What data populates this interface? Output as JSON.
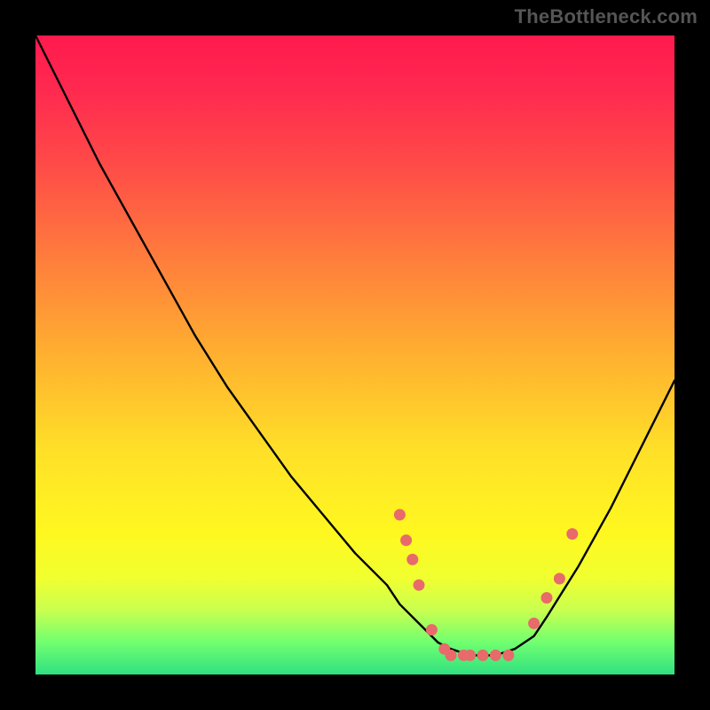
{
  "watermark": "TheBottleneck.com",
  "chart_data": {
    "type": "line",
    "title": "",
    "xlabel": "",
    "ylabel": "",
    "xlim": [
      0,
      100
    ],
    "ylim": [
      0,
      100
    ],
    "series": [
      {
        "name": "bottleneck-curve",
        "x": [
          0,
          5,
          10,
          15,
          20,
          25,
          30,
          35,
          40,
          45,
          50,
          55,
          57,
          60,
          63,
          65,
          68,
          70,
          72,
          75,
          78,
          80,
          85,
          90,
          95,
          100
        ],
        "y_percent_from_top": [
          0,
          10,
          20,
          29,
          38,
          47,
          55,
          62,
          69,
          75,
          81,
          86,
          89,
          92,
          95,
          96,
          97,
          97,
          97,
          96,
          94,
          91,
          83,
          74,
          64,
          54
        ]
      }
    ],
    "markers": {
      "name": "highlight-points",
      "color": "#e86a6a",
      "x": [
        57,
        58,
        59,
        60,
        62,
        64,
        65,
        67,
        68,
        70,
        72,
        74,
        78,
        80,
        82,
        84
      ],
      "y_percent_from_top": [
        75,
        79,
        82,
        86,
        93,
        96,
        97,
        97,
        97,
        97,
        97,
        97,
        92,
        88,
        85,
        78
      ]
    },
    "background_gradient": {
      "top": "#ff1a4d",
      "mid": "#ffe028",
      "bottom": "#30e080"
    }
  }
}
